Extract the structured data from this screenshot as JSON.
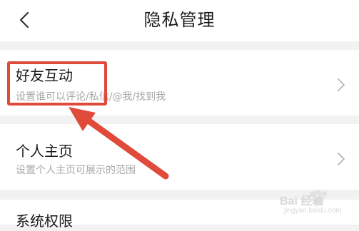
{
  "header": {
    "title": "隐私管理",
    "back_icon": "chevron-left-icon"
  },
  "settings": {
    "items": [
      {
        "title": "好友互动",
        "subtitle": "设置谁可以评论/私信/@我/找到我",
        "icon": "chevron-right-icon"
      },
      {
        "title": "个人主页",
        "subtitle": "设置个人主页可展示的范围",
        "icon": "chevron-right-icon"
      },
      {
        "title": "系统权限",
        "subtitle": "",
        "icon": "chevron-right-icon"
      }
    ]
  },
  "annotation": {
    "color": "#e04a3a"
  },
  "watermark": {
    "text": "Bai 经验",
    "url": "jingyan.baidu.com"
  }
}
